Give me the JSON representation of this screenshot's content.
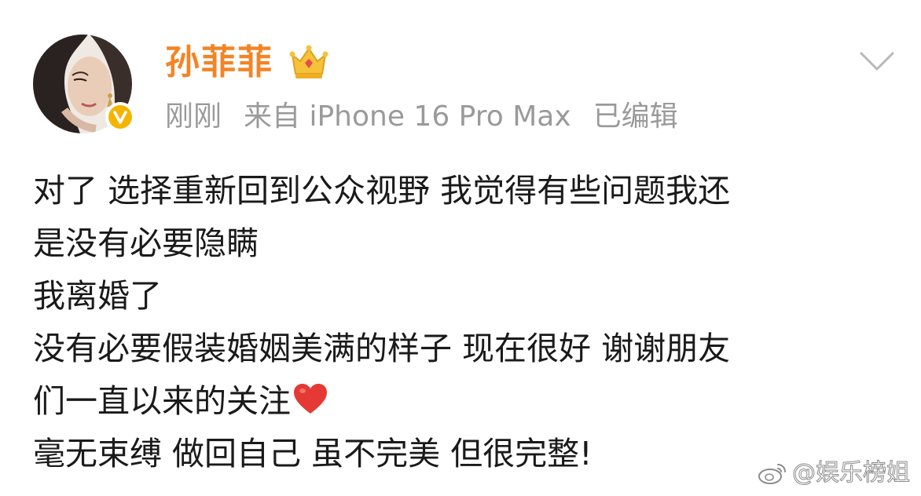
{
  "post": {
    "author": {
      "name": "孙菲菲",
      "badges": [
        "crown-badge",
        "verified-badge"
      ]
    },
    "meta": {
      "time": "刚刚",
      "source": "来自 iPhone 16 Pro Max",
      "edited": "已编辑"
    },
    "body_lines": [
      "对了 选择重新回到公众视野 我觉得有些问题我还",
      "是没有必要隐瞒",
      "我离婚了",
      "没有必要假装婚姻美满的样子 现在很好 谢谢朋友",
      "们一直以来的关注",
      "毫无束缚 做回自己 虽不完美 但很完整!"
    ],
    "emoji": "red-heart-emoji"
  },
  "watermark": {
    "text": "@娱乐榜姐"
  },
  "colors": {
    "name": "#f28426",
    "meta": "#9a9a9a",
    "body": "#1a1a1a",
    "verified": "#f5b400",
    "heart": "#e53935"
  }
}
